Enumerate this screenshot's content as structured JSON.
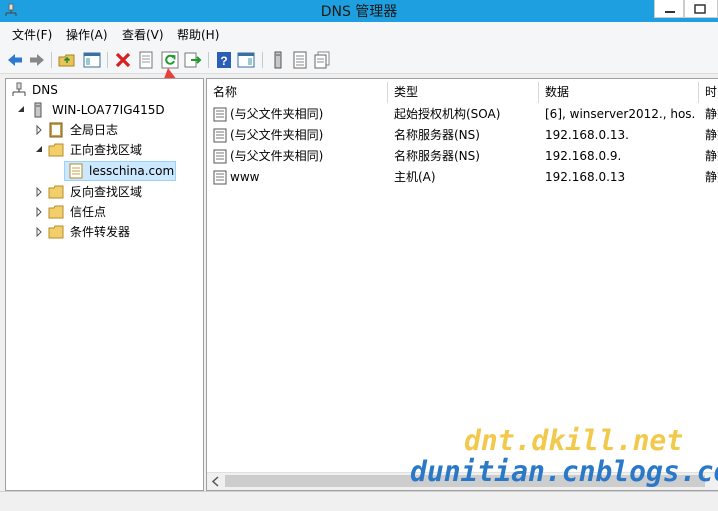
{
  "window": {
    "title": "DNS 管理器"
  },
  "menu": [
    "文件(F)",
    "操作(A)",
    "查看(V)",
    "帮助(H)"
  ],
  "toolbar": {
    "icons": [
      "back-icon",
      "forward-icon",
      "up-folder-icon",
      "show-hide-tree-icon",
      "delete-icon",
      "properties-icon",
      "refresh-icon",
      "export-list-icon",
      "help-icon",
      "show-hide-action-pane-icon",
      "server-icon",
      "zone-records-icon",
      "new-record-icon"
    ]
  },
  "tree": {
    "root": "DNS",
    "server": "WIN-LOA77IG415D",
    "items": [
      "全局日志",
      "正向查找区域",
      "lesschina.com",
      "反向查找区域",
      "信任点",
      "条件转发器"
    ]
  },
  "list": {
    "columns": [
      "名称",
      "类型",
      "数据",
      "时间"
    ],
    "rows": [
      {
        "name": "(与父文件夹相同)",
        "type": "起始授权机构(SOA)",
        "data": "[6], winserver2012., hos...",
        "ts": "静态"
      },
      {
        "name": "(与父文件夹相同)",
        "type": "名称服务器(NS)",
        "data": "192.168.0.13.",
        "ts": "静态"
      },
      {
        "name": "(与父文件夹相同)",
        "type": "名称服务器(NS)",
        "data": "192.168.0.9.",
        "ts": "静态"
      },
      {
        "name": "www",
        "type": "主机(A)",
        "data": "192.168.0.13",
        "ts": "静态"
      }
    ]
  },
  "watermark": {
    "line1": "dnt.dkill.net",
    "line2": "dunitian.cnblogs.com"
  },
  "colors": {
    "titlebar": "#1e9fe0",
    "selection": "#cce8ff",
    "arrow": "#e8403a"
  }
}
